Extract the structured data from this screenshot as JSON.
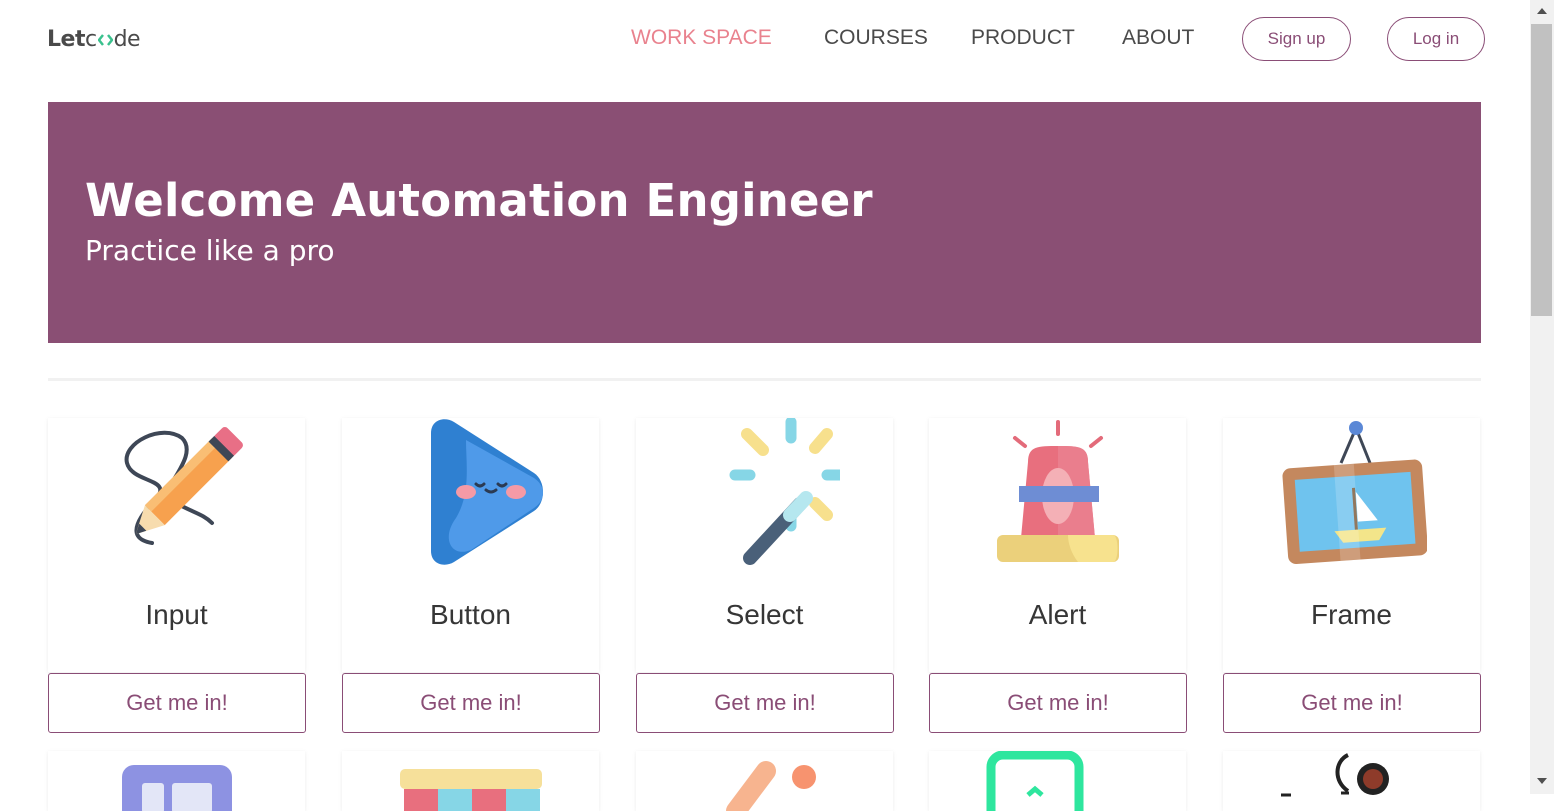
{
  "brand": {
    "part1": "Let",
    "part2": "de"
  },
  "nav": {
    "items": [
      "WORK SPACE",
      "COURSES",
      "PRODUCT",
      "ABOUT"
    ],
    "signup": "Sign up",
    "login": "Log in"
  },
  "hero": {
    "title": "Welcome Automation Engineer",
    "subtitle": "Practice like a pro"
  },
  "cards": [
    {
      "title": "Input",
      "icon": "pencil-icon",
      "button": "Get me in!"
    },
    {
      "title": "Button",
      "icon": "play-icon",
      "button": "Get me in!"
    },
    {
      "title": "Select",
      "icon": "magic-wand-icon",
      "button": "Get me in!"
    },
    {
      "title": "Alert",
      "icon": "siren-icon",
      "button": "Get me in!"
    },
    {
      "title": "Frame",
      "icon": "frame-icon",
      "button": "Get me in!"
    }
  ],
  "colors": {
    "accent": "#8a4d76",
    "hero": "#8a4f74",
    "active_nav": "#e9828e"
  }
}
